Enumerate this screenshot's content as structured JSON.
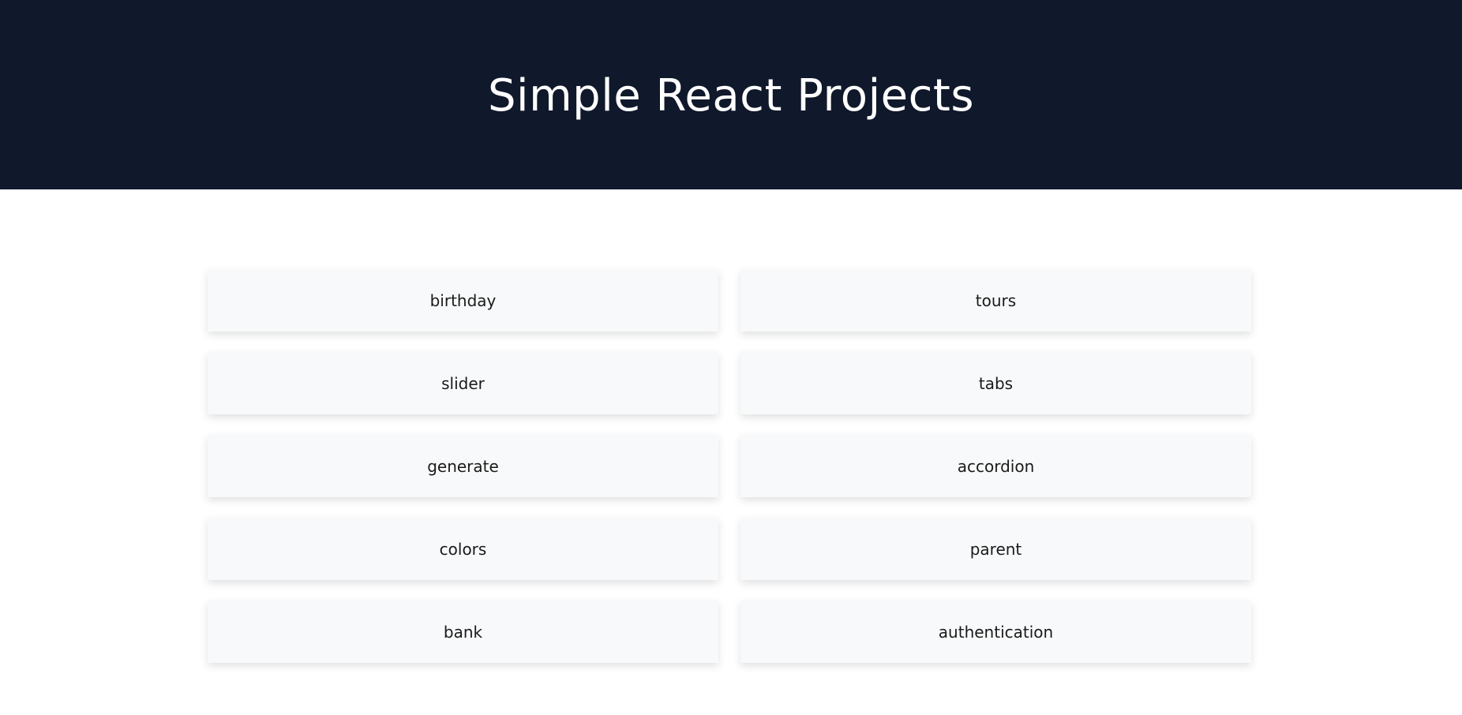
{
  "header": {
    "title": "Simple React Projects"
  },
  "projects": [
    {
      "label": "birthday"
    },
    {
      "label": "tours"
    },
    {
      "label": "slider"
    },
    {
      "label": "tabs"
    },
    {
      "label": "generate"
    },
    {
      "label": "accordion"
    },
    {
      "label": "colors"
    },
    {
      "label": "parent"
    },
    {
      "label": "bank"
    },
    {
      "label": "authentication"
    }
  ],
  "colors": {
    "header_bg": "#10182b",
    "card_bg": "#f8f9fa",
    "page_bg": "#ffffff"
  }
}
